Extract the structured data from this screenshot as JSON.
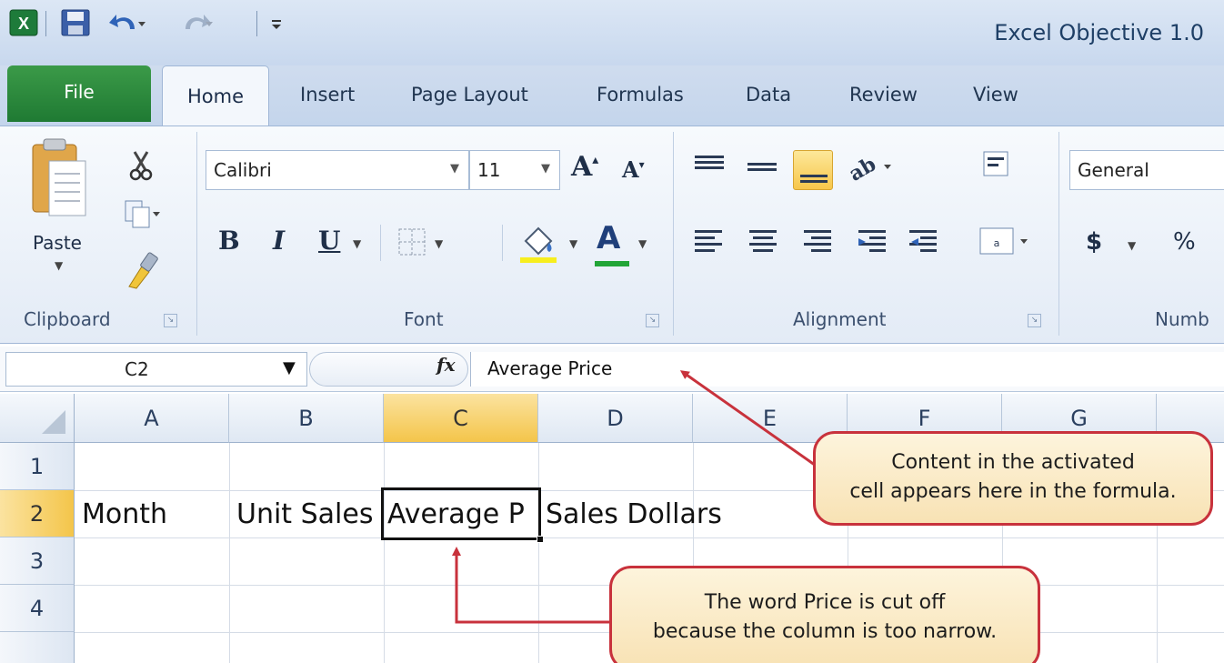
{
  "window": {
    "title": "Excel Objective 1.0"
  },
  "quick_access": {
    "icons": [
      "excel-logo-icon",
      "save-icon",
      "undo-icon",
      "redo-icon",
      "customize-qat-icon"
    ]
  },
  "tabs": [
    {
      "label": "File"
    },
    {
      "label": "Home"
    },
    {
      "label": "Insert"
    },
    {
      "label": "Page Layout"
    },
    {
      "label": "Formulas"
    },
    {
      "label": "Data"
    },
    {
      "label": "Review"
    },
    {
      "label": "View"
    }
  ],
  "ribbon": {
    "clipboard": {
      "label": "Clipboard",
      "paste_label": "Paste"
    },
    "font": {
      "label": "Font",
      "font_name": "Calibri",
      "font_size": "11",
      "bold": "B",
      "italic": "I",
      "underline": "U",
      "grow_font": "A",
      "shrink_font": "A",
      "font_color": "A"
    },
    "alignment": {
      "label": "Alignment"
    },
    "number": {
      "label": "Numb",
      "format": "General",
      "currency": "$",
      "percent": "%"
    }
  },
  "formula_bar": {
    "name_box": "C2",
    "fx_label": "fx",
    "content": "Average Price"
  },
  "grid": {
    "columns": [
      "A",
      "B",
      "C",
      "D",
      "E",
      "F",
      "G"
    ],
    "active_column": "C",
    "rows": [
      "1",
      "2",
      "3",
      "4"
    ],
    "active_row": "2",
    "cells": {
      "A2": "Month",
      "B2": "Unit Sales",
      "C2": "Average P",
      "D2": "Sales Dollars"
    }
  },
  "callouts": {
    "top": {
      "line1": "Content in the activated",
      "line2": "cell appears here in the formula."
    },
    "bottom": {
      "line1": "The word Price is cut off",
      "line2": "because the column is too narrow."
    }
  },
  "colors": {
    "file_tab": "#2e8b3f",
    "active_header": "#f4c54a",
    "callout_border": "#c8323c",
    "callout_fill": "#fbeccb",
    "arrow": "#c8323c"
  }
}
